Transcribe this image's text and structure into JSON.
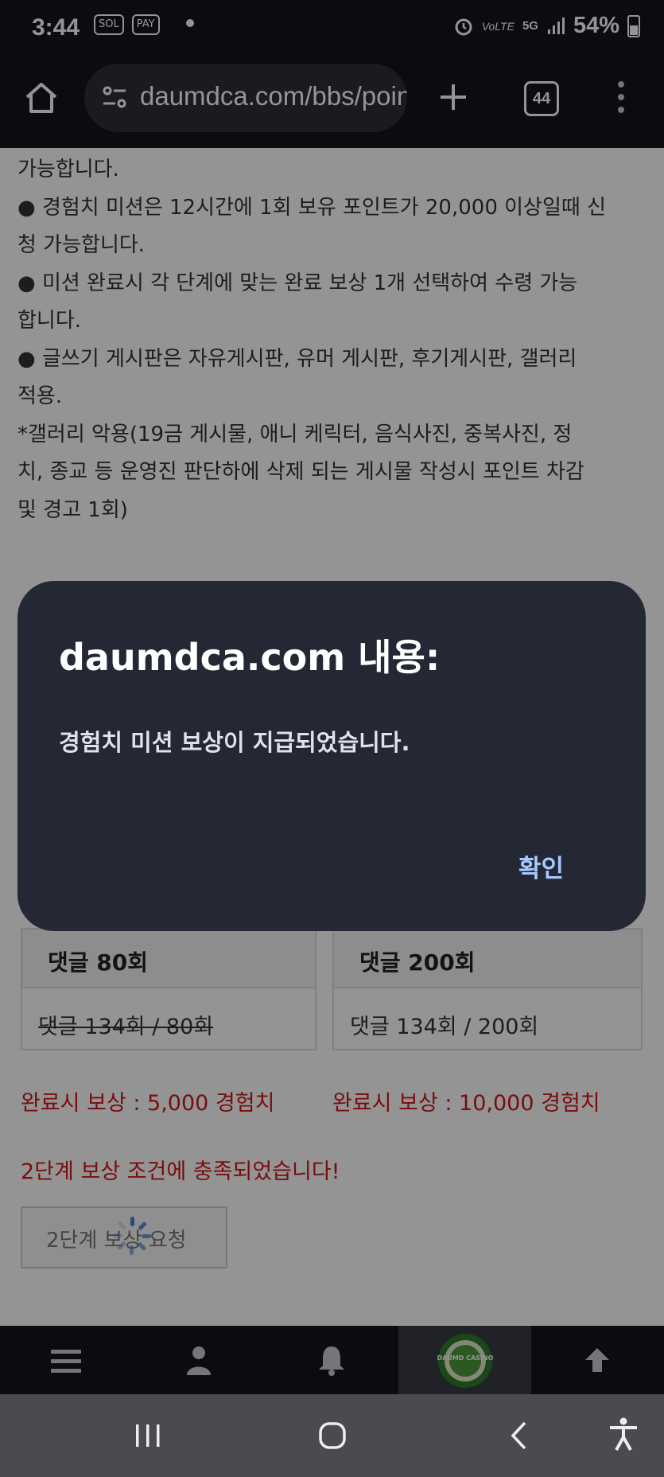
{
  "status_bar": {
    "time": "3:44",
    "left_badges": [
      "SOL",
      "PAY"
    ],
    "signal_labels": [
      "VoLTE",
      "5G"
    ],
    "battery_text": "54%"
  },
  "browser": {
    "url": "daumdca.com/bbs/point",
    "tab_count": "44"
  },
  "page": {
    "lines": [
      "가능합니다.",
      "● 경험치 미션은 12시간에 1회 보유 포인트가 20,000 이상일때 신",
      "청 가능합니다.",
      "● 미션 완료시 각 단계에 맞는 완료 보상 1개 선택하여 수령 가능",
      "합니다.",
      "● 글쓰기 게시판은 자유게시판, 유머 게시판, 후기게시판, 갤러리",
      "적용.",
      "   *갤러리 악용(19금 게시물, 애니 케릭터, 음식사진, 중복사진, 정",
      "치, 종교 등 운영진 판단하에 삭제 되는 게시물 작성시 포인트 차감",
      "및 경고 1회)"
    ],
    "missions": [
      {
        "title": "댓글 80회",
        "progress": "댓글 134회 / 80회",
        "reward": "완료시 보상 : 5,000 경험치"
      },
      {
        "title": "댓글 200회",
        "progress": "댓글 134회 / 200회",
        "reward": "완료시 보상 : 10,000 경험치"
      }
    ],
    "stage_notice": "2단계 보상 조건에 충족되었습니다!",
    "request_button": "2단계 보상 요청"
  },
  "site_nav": {
    "casino_logo_text": "DAUMD CASINO"
  },
  "dialog": {
    "title": "daumdca.com 내용:",
    "message": "경험치 미션 보상이 지급되었습니다.",
    "ok_label": "확인"
  },
  "colors": {
    "dialog_bg": "#242835",
    "ok_text": "#a9c7ff",
    "reward_text": "#d01818"
  }
}
